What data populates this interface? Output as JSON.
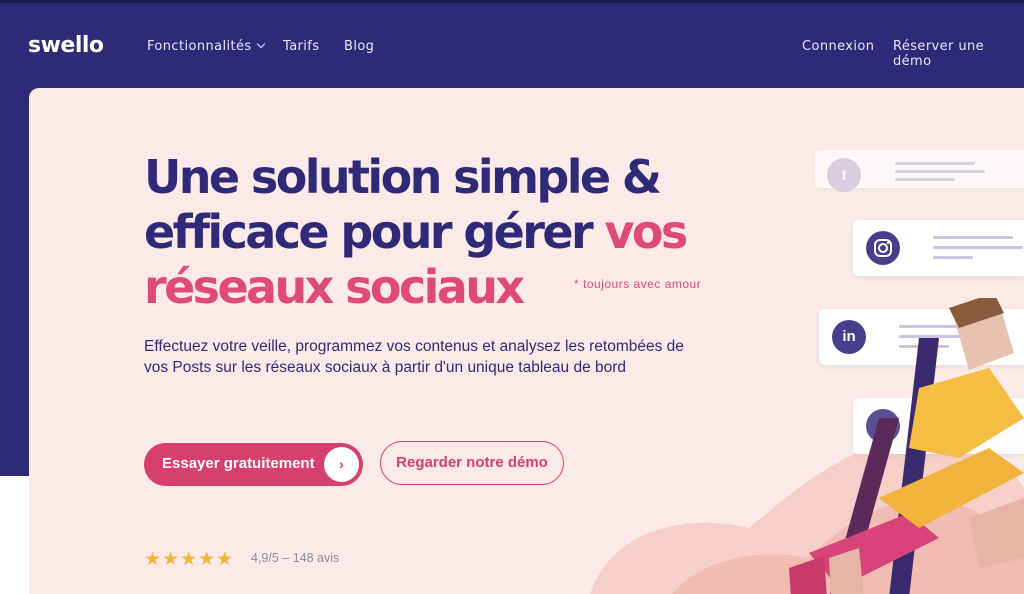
{
  "brand": {
    "logo_text": "swello"
  },
  "nav": {
    "features": "Fonctionnalités",
    "pricing": "Tarifs",
    "blog": "Blog",
    "login": "Connexion",
    "book_demo": "Réserver une démo"
  },
  "hero": {
    "title_line1": "Une solution simple &",
    "title_line2": "efficace pour gérer ",
    "title_highlight1": "vos",
    "title_highlight2": "réseaux sociaux",
    "footnote": "* toujours avec amour",
    "subtitle": "Effectuez votre veille, programmez vos contenus et analysez les retombées de vos Posts sur les réseaux sociaux à partir d'un unique tableau de bord",
    "cta_primary": "Essayer gratuitement",
    "cta_primary_arrow": "›",
    "cta_secondary": "Regarder notre démo",
    "stars": "★★★★★",
    "rating_text": "4,9/5 – 148 avis"
  },
  "social_cards": {
    "facebook_glyph": "f",
    "instagram_icon": "instagram-icon",
    "linkedin_glyph": "in",
    "tiktok_glyph": "♪"
  },
  "colors": {
    "nav_bg": "#2e2a78",
    "hero_bg": "#fbeae7",
    "accent_pink": "#e04a78",
    "star": "#f3b63a"
  }
}
